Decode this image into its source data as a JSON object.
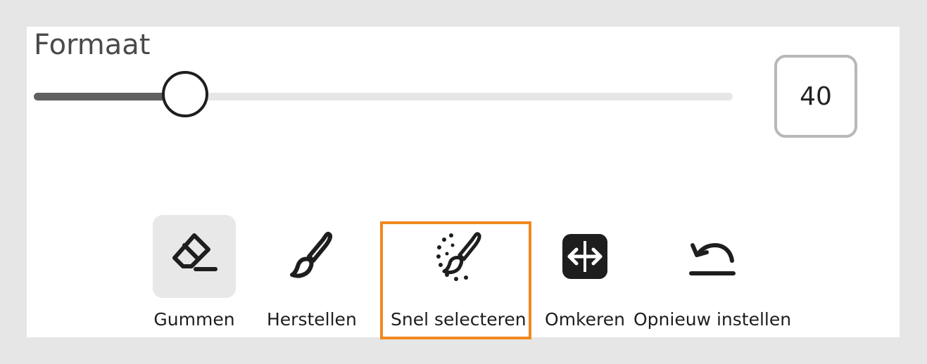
{
  "section": {
    "title": "Formaat"
  },
  "slider": {
    "value": 40,
    "value_text": "40",
    "fill_fraction": 0.217
  },
  "tools": [
    {
      "label": "Gummen",
      "icon": "eraser-icon",
      "active": true
    },
    {
      "label": "Herstellen",
      "icon": "brush-icon",
      "active": false
    },
    {
      "label": "Snel selecteren",
      "icon": "quick-select-brush-icon",
      "active": false,
      "highlighted": true
    },
    {
      "label": "Omkeren",
      "icon": "invert-icon",
      "active": false
    },
    {
      "label": "Opnieuw instellen",
      "icon": "reset-icon",
      "active": false
    }
  ],
  "colors": {
    "highlight": "#f0891e",
    "slider_fill": "#606060",
    "active_tool_bg": "#e8e8e8"
  }
}
